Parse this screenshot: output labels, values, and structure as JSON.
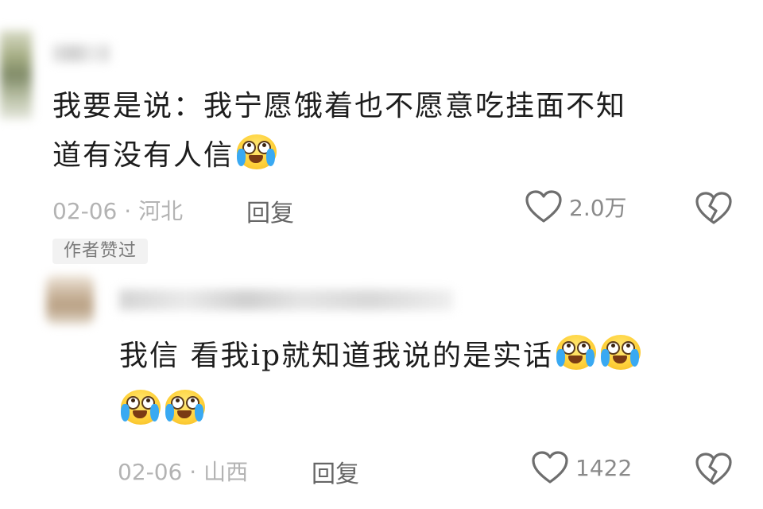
{
  "comments": [
    {
      "text_line1": "我要是说：我宁愿饿着也不愿意吃挂面不知",
      "text_line2": "道有没有人信",
      "emoji": "crying-laughing-emoji",
      "date": "02-06",
      "location": "河北",
      "reply_label": "回复",
      "likes": "2.0万",
      "author_badge": "作者赞过"
    },
    {
      "text_line1": "我信 看我ip就知道我说的是实话",
      "emoji": "crying-laughing-emoji",
      "date": "02-06",
      "location": "山西",
      "reply_label": "回复",
      "likes": "1422"
    }
  ],
  "icons": {
    "like": "heart-outline-icon",
    "dislike": "broken-heart-icon"
  },
  "colors": {
    "text": "#1d1d1d",
    "meta": "#b3b3b3",
    "icon": "#6e6e6e",
    "badge_bg": "#f2f2f2"
  }
}
